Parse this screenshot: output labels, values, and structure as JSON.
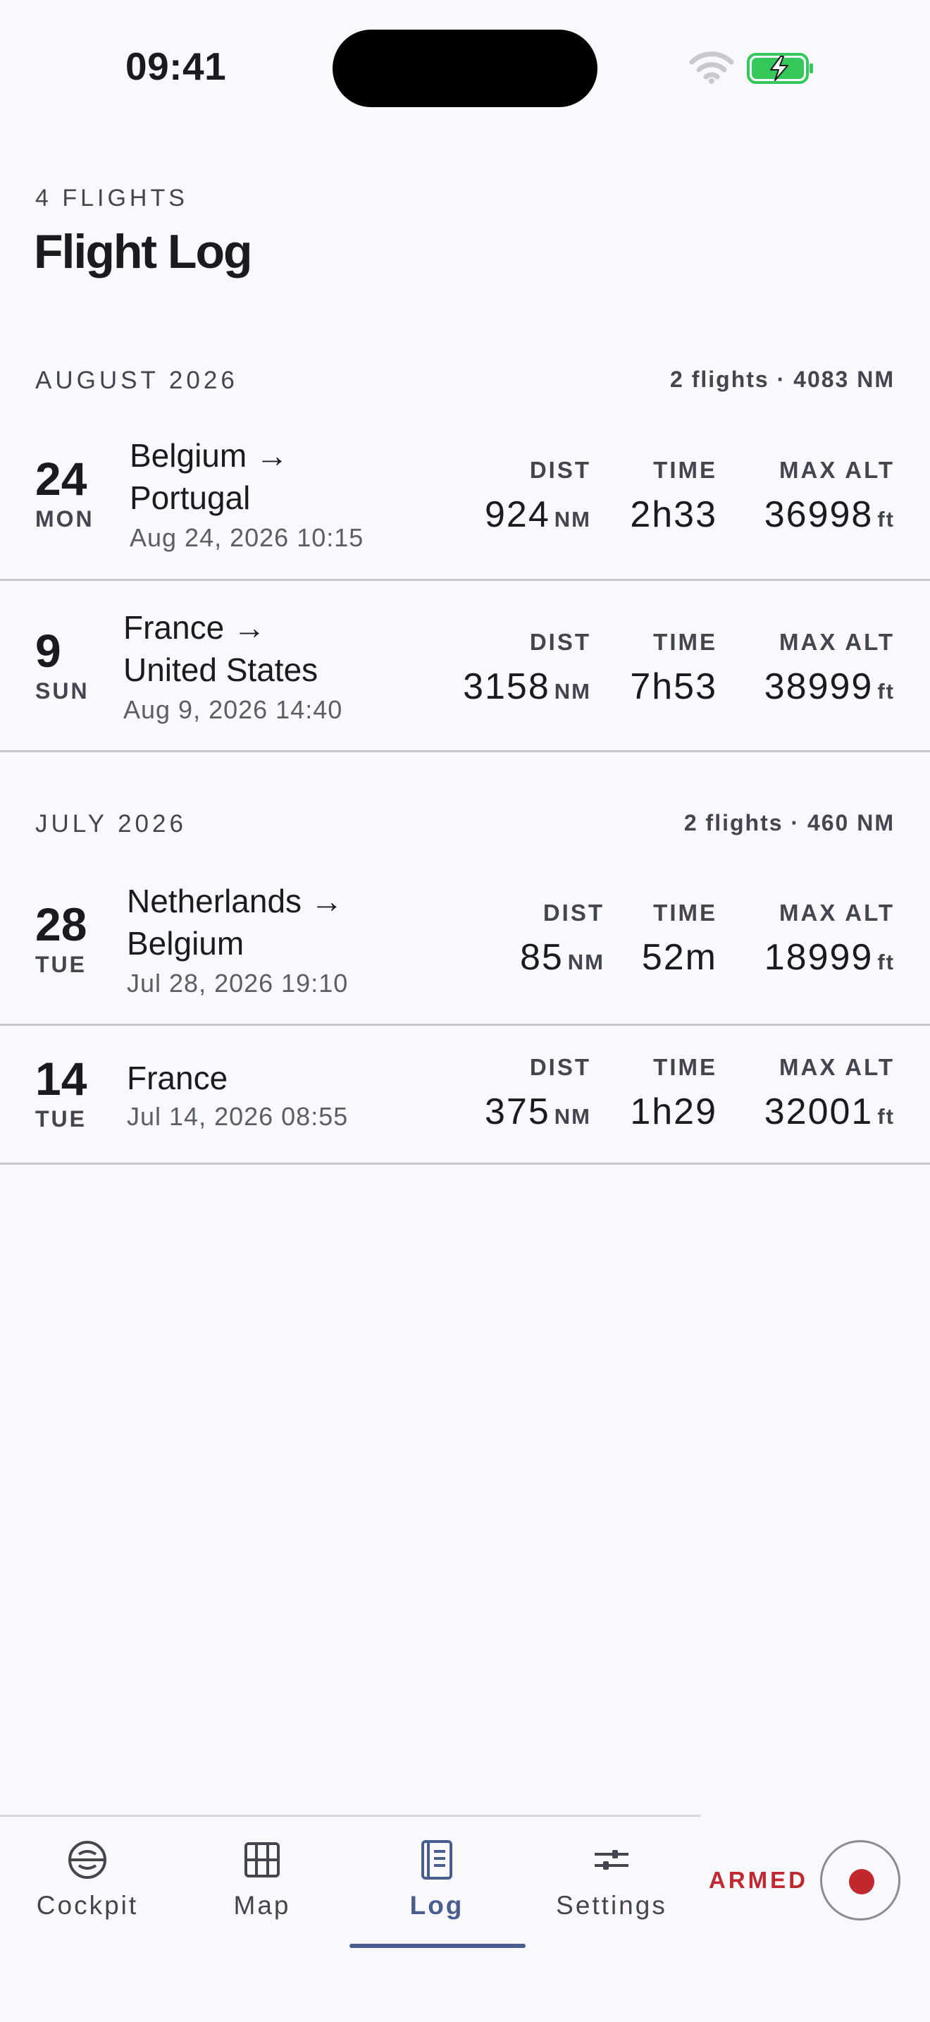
{
  "status_bar": {
    "time": "09:41"
  },
  "header": {
    "count": "4 FLIGHTS",
    "title": "Flight Log"
  },
  "months": [
    {
      "name": "AUGUST 2026",
      "summary": "2 flights · 4083 NM",
      "flights": [
        {
          "day": "24",
          "weekday": "MON",
          "route_line1": "Belgium →",
          "route_line2": "Portugal",
          "datetime": "Aug 24, 2026 10:15",
          "dist": "924",
          "dist_unit": "NM",
          "time": "2h33",
          "max_alt": "36998",
          "alt_unit": "ft"
        },
        {
          "day": "9",
          "weekday": "SUN",
          "route_line1": "France →",
          "route_line2": "United States",
          "datetime": "Aug 9, 2026 14:40",
          "dist": "3158",
          "dist_unit": "NM",
          "time": "7h53",
          "max_alt": "38999",
          "alt_unit": "ft"
        }
      ]
    },
    {
      "name": "JULY 2026",
      "summary": "2 flights · 460 NM",
      "flights": [
        {
          "day": "28",
          "weekday": "TUE",
          "route_line1": "Netherlands →",
          "route_line2": "Belgium",
          "datetime": "Jul 28, 2026 19:10",
          "dist": "85",
          "dist_unit": "NM",
          "time": "52m",
          "max_alt": "18999",
          "alt_unit": "ft"
        },
        {
          "day": "14",
          "weekday": "TUE",
          "route_line1": "France",
          "route_line2": "",
          "datetime": "Jul 14, 2026 08:55",
          "dist": "375",
          "dist_unit": "NM",
          "time": "1h29",
          "max_alt": "32001",
          "alt_unit": "ft"
        }
      ]
    }
  ],
  "stat_labels": {
    "dist": "DIST",
    "time": "TIME",
    "max_alt": "MAX ALT"
  },
  "nav": {
    "items": [
      {
        "label": "Cockpit",
        "icon": "cockpit-icon"
      },
      {
        "label": "Map",
        "icon": "map-icon"
      },
      {
        "label": "Log",
        "icon": "log-icon",
        "active": true
      },
      {
        "label": "Settings",
        "icon": "settings-icon"
      }
    ],
    "armed_label": "ARMED"
  },
  "colors": {
    "accent": "#4a5d8f",
    "armed": "#c0282d",
    "battery": "#34c759",
    "background": "#f8f8fd"
  }
}
